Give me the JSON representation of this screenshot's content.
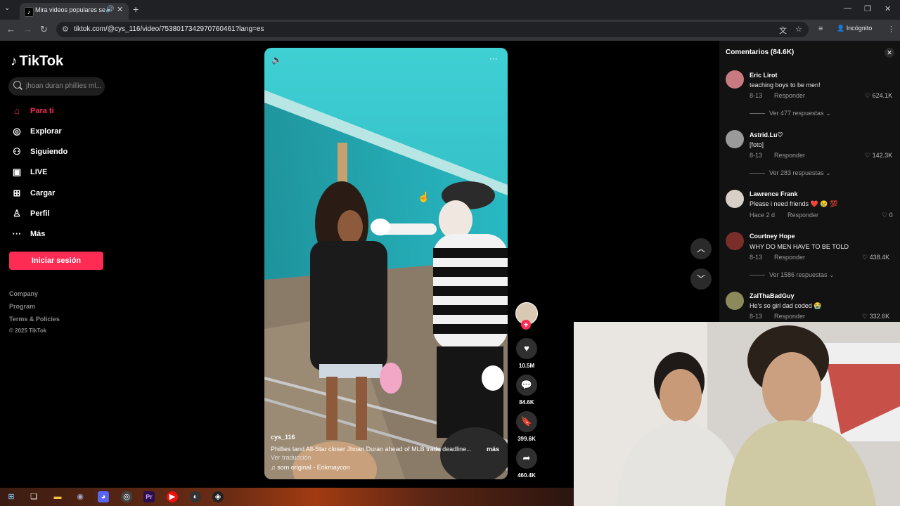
{
  "browser": {
    "tab_title": "Mira videos populares sele",
    "url": "tiktok.com/@cys_116/video/7538017342970760461?lang=es",
    "incognito_label": "Incógnito",
    "icons": [
      "tab-menu-icon",
      "audio-icon",
      "close-icon",
      "new-tab-icon",
      "back-icon",
      "forward-icon",
      "reload-icon",
      "site-info-icon",
      "translate-icon",
      "star-icon",
      "media-icon",
      "incognito-icon",
      "kebab-icon",
      "minimize-icon",
      "restore-icon",
      "close-window-icon"
    ]
  },
  "sidebar": {
    "logo_text": "TikTok",
    "search_placeholder": "jhoan duran phillies ml...",
    "nav": [
      {
        "label": "Para ti",
        "icon": "home-icon",
        "active": true
      },
      {
        "label": "Explorar",
        "icon": "compass-icon"
      },
      {
        "label": "Siguiendo",
        "icon": "following-icon"
      },
      {
        "label": "LIVE",
        "icon": "live-icon"
      },
      {
        "label": "Cargar",
        "icon": "upload-icon"
      },
      {
        "label": "Perfil",
        "icon": "profile-icon"
      },
      {
        "label": "Más",
        "icon": "more-icon"
      }
    ],
    "login_label": "Iniciar sesión",
    "footer": [
      "Company",
      "Program",
      "Terms & Policies"
    ],
    "copyright": "© 2025 TikTok"
  },
  "video": {
    "username": "cys_116",
    "caption": "Phillies land All-Star closer Jhoan Duran ahead of MLB trade deadline...",
    "more_label": "más",
    "translate_label": "Ver traducción",
    "sound": "som original - Erikmaycon"
  },
  "actions": {
    "likes": "10.5M",
    "comments": "84.6K",
    "saves": "399.6K",
    "shares": "460.4K"
  },
  "comments": {
    "title": "Comentarios (84.6K)",
    "items": [
      {
        "name": "Eric Lirot",
        "text": "teaching boys to be men!",
        "date": "8-13",
        "reply": "Responder",
        "likes": "624.1K",
        "view_replies": "Ver 477 respuestas",
        "avatar_color": "#c77a80"
      },
      {
        "name": "Astrid.Lu♡",
        "text": "[foto]",
        "date": "8-13",
        "reply": "Responder",
        "likes": "142.3K",
        "view_replies": "Ver 283 respuestas",
        "avatar_color": "#9a9a9a"
      },
      {
        "name": "Lawrence Frank",
        "text": "Please i need friends ❤️ 😢 💯",
        "date": "Hace 2 d",
        "reply": "Responder",
        "likes": "0",
        "view_replies": "",
        "avatar_color": "#d7d0c8"
      },
      {
        "name": "Courtney Hope",
        "text": "WHY DO MEN HAVE TO BE TOLD",
        "date": "8-13",
        "reply": "Responder",
        "likes": "438.4K",
        "view_replies": "Ver 1586 respuestas",
        "avatar_color": "#7a2e2a"
      },
      {
        "name": "ZaIThaBadGuy",
        "text": "He's so girl dad coded 😭",
        "date": "8-13",
        "reply": "Responder",
        "likes": "332.6K",
        "view_replies": "",
        "avatar_color": "#8a8a5a"
      }
    ]
  },
  "taskbar": {
    "icons": [
      "windows-start-icon",
      "task-view-icon",
      "file-explorer-icon",
      "steam-icon",
      "discord-icon",
      "chrome-icon",
      "premiere-icon",
      "youtube-music-icon",
      "obs-icon",
      "app-icon"
    ]
  }
}
